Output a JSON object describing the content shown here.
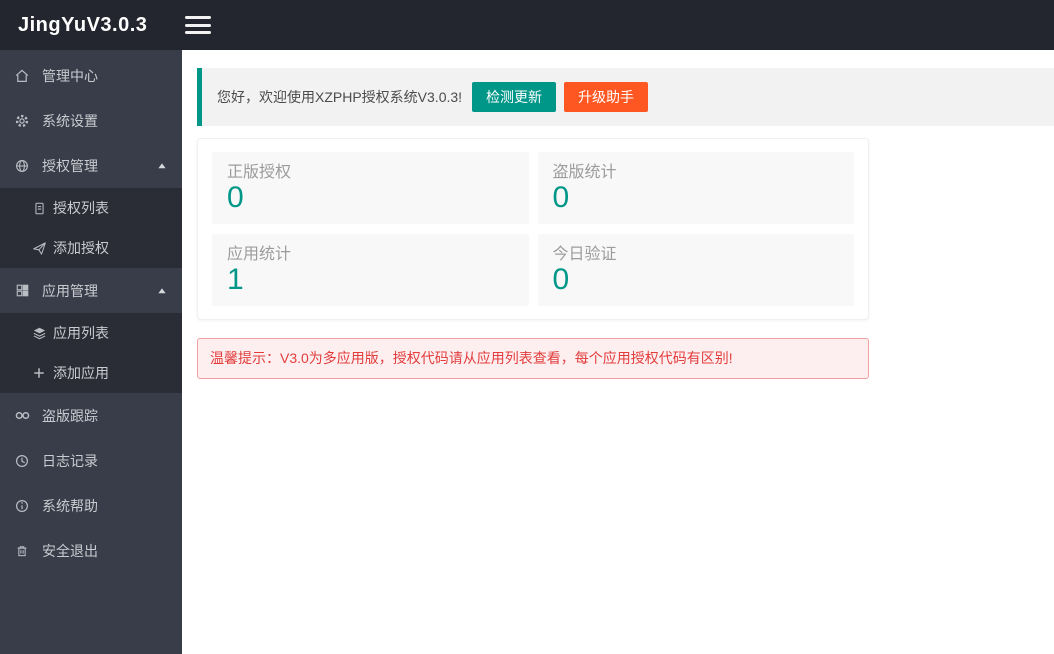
{
  "topbar": {
    "brand": "JingYuV3.0.3",
    "menu_toggle_icon": "hamburger-icon"
  },
  "sidebar": {
    "items": [
      {
        "label": "管理中心",
        "icon": "home-icon"
      },
      {
        "label": "系统设置",
        "icon": "gear-icon"
      },
      {
        "label": "授权管理",
        "icon": "globe-icon",
        "expanded": true,
        "children": [
          {
            "label": "授权列表",
            "icon": "document-icon"
          },
          {
            "label": "添加授权",
            "icon": "send-icon"
          }
        ]
      },
      {
        "label": "应用管理",
        "icon": "component-icon",
        "expanded": true,
        "children": [
          {
            "label": "应用列表",
            "icon": "layers-icon"
          },
          {
            "label": "添加应用",
            "icon": "plus-icon"
          }
        ]
      },
      {
        "label": "盗版跟踪",
        "icon": "infinity-icon"
      },
      {
        "label": "日志记录",
        "icon": "clock-icon"
      },
      {
        "label": "系统帮助",
        "icon": "info-icon"
      },
      {
        "label": "安全退出",
        "icon": "trash-icon"
      }
    ]
  },
  "main": {
    "welcome": {
      "message": "您好，欢迎使用XZPHP授权系统V3.0.3!",
      "buttons": [
        {
          "label": "检测更新",
          "color": "#009688"
        },
        {
          "label": "升级助手",
          "color": "#FF5722"
        }
      ]
    },
    "stats": [
      {
        "label": "正版授权",
        "value": "0"
      },
      {
        "label": "盗版统计",
        "value": "0"
      },
      {
        "label": "应用统计",
        "value": "1"
      },
      {
        "label": "今日验证",
        "value": "0"
      }
    ],
    "notice": "温馨提示：V3.0为多应用版，授权代码请从应用列表查看，每个应用授权代码有区别!"
  },
  "colors": {
    "topbar_bg": "#23262e",
    "sidebar_bg": "#393d49",
    "sidebar_submenu_bg": "#2a2d36",
    "accent_teal": "#009688",
    "accent_orange": "#ff5722",
    "notice_red": "#e23c3c",
    "quote_bg": "#f2f2f2",
    "card_bg": "#f8f8f8"
  }
}
